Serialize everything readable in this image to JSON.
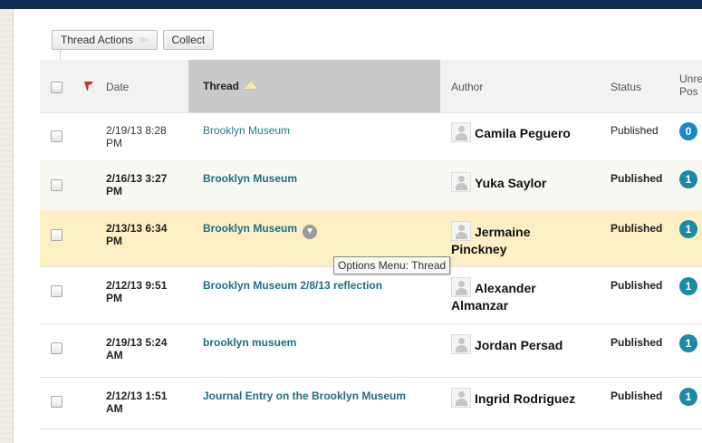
{
  "toolbar": {
    "thread_actions_label": "Thread Actions",
    "collect_label": "Collect"
  },
  "table": {
    "headers": {
      "date": "Date",
      "thread": "Thread",
      "author": "Author",
      "status": "Status",
      "unread_line1": "Unre",
      "unread_line2": "Pos"
    },
    "rows": [
      {
        "date_line1": "2/19/13 8:28",
        "date_line2": "PM",
        "thread": "Brooklyn Museum",
        "author_line1": "Camila Peguero",
        "author_line2": "",
        "status": "Published",
        "unread": "0"
      },
      {
        "date_line1": "2/16/13 3:27",
        "date_line2": "PM",
        "thread": "Brooklyn Museum",
        "author_line1": "Yuka Saylor",
        "author_line2": "",
        "status": "Published",
        "unread": "1"
      },
      {
        "date_line1": "2/13/13 6:34",
        "date_line2": "PM",
        "thread": "Brooklyn Museum",
        "author_line1": "Jermaine",
        "author_line2": "Pinckney",
        "status": "Published",
        "unread": "1"
      },
      {
        "date_line1": "2/12/13 9:51",
        "date_line2": "PM",
        "thread": "Brooklyn Museum 2/8/13 reflection",
        "author_line1": "Alexander",
        "author_line2": "Almanzar",
        "status": "Published",
        "unread": "1"
      },
      {
        "date_line1": "2/19/13 5:24",
        "date_line2": "AM",
        "thread": "brooklyn musuem",
        "author_line1": "Jordan Persad",
        "author_line2": "",
        "status": "Published",
        "unread": "1"
      },
      {
        "date_line1": "2/12/13 1:51",
        "date_line2": "AM",
        "thread": "Journal Entry on the Brooklyn Museum",
        "author_line1": "Ingrid Rodriguez",
        "author_line2": "",
        "status": "Published",
        "unread": "1"
      }
    ]
  },
  "tooltip": {
    "text": "Options Menu: Thread"
  },
  "colors": {
    "topbar": "#0e2c52",
    "link": "#2b7a8c",
    "highlight_row": "#fcefc3",
    "badge_teal": "#1c8aa4",
    "badge_blue": "#1a86c4"
  }
}
